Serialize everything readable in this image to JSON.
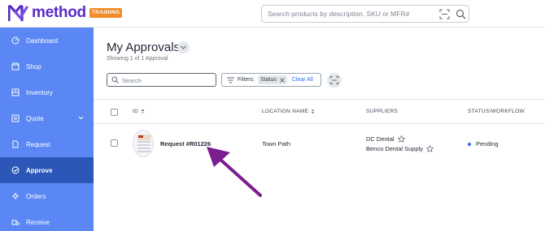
{
  "app": {
    "logo_text": "method",
    "badge": "TRAINING",
    "search_placeholder": "Search products by description, SKU or MFR#"
  },
  "sidebar": {
    "items": [
      {
        "label": "Dashboard",
        "icon": "dashboard-icon"
      },
      {
        "label": "Shop",
        "icon": "shop-icon"
      },
      {
        "label": "Inventory",
        "icon": "inventory-icon"
      },
      {
        "label": "Quote",
        "icon": "quote-icon",
        "has_chevron": true
      },
      {
        "label": "Request",
        "icon": "request-icon"
      },
      {
        "label": "Approve",
        "icon": "approve-icon",
        "active": true
      },
      {
        "label": "Orders",
        "icon": "orders-icon"
      },
      {
        "label": "Receive",
        "icon": "receive-icon"
      }
    ]
  },
  "main": {
    "title": "My Approvals",
    "showing": "Showing 1 of 1 Approval",
    "search_placeholder": "Search",
    "filters": {
      "label": "Filters:",
      "chip": "Status",
      "clear": "Clear All"
    },
    "columns": {
      "id": "ID",
      "location": "LOCATION NAME",
      "suppliers": "SUPPLIERS",
      "status": "STATUS/WORKFLOW"
    },
    "rows": [
      {
        "id": "Request #R01226",
        "location": "Town Path",
        "suppliers": [
          "DC Dental",
          "Benco Dental Supply"
        ],
        "status": "Pending"
      }
    ]
  },
  "colors": {
    "brand": "#5b2bc8",
    "sidebar": "#5a87f3",
    "sidebar_active": "#2c57b8",
    "badge": "#f28b2a",
    "link": "#2f6ae8",
    "annotation_arrow": "#7a1e8f"
  }
}
